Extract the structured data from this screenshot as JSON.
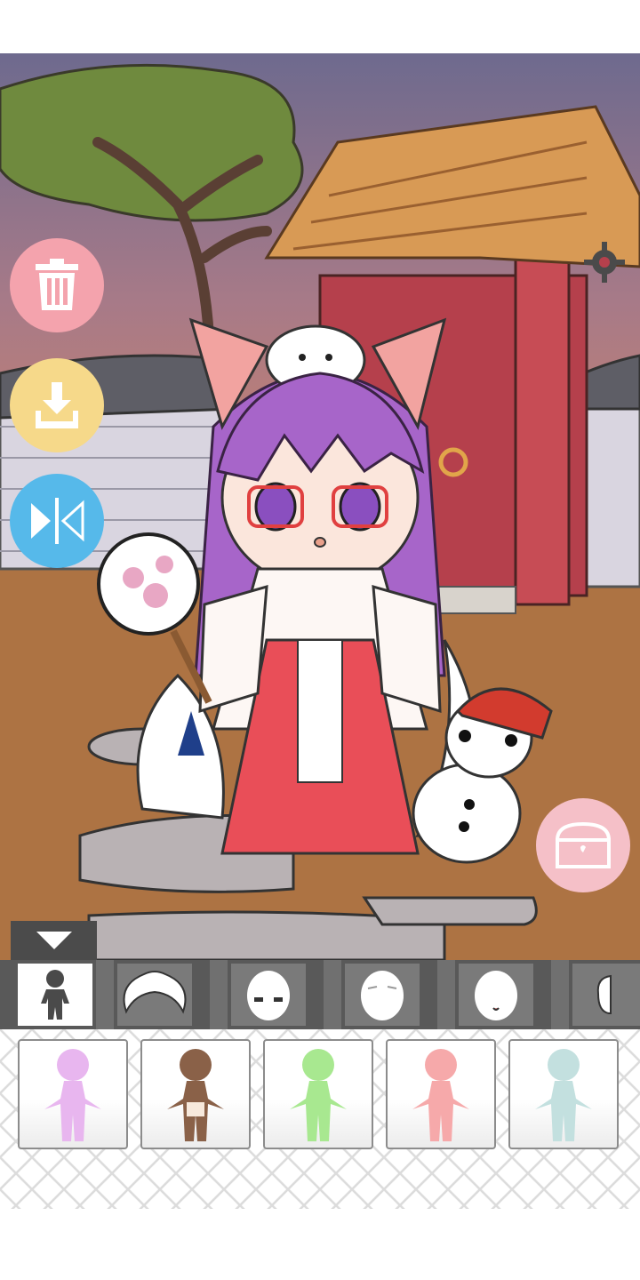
{
  "app": {
    "accent_colors": {
      "delete": "#f4a3ad",
      "download": "#f6d98a",
      "flip": "#56b9ea",
      "chest": "#f5c0c8",
      "toolbar": "#595959"
    }
  },
  "side_buttons": [
    {
      "icon": "trash-icon"
    },
    {
      "icon": "download-icon"
    },
    {
      "icon": "flip-horizontal-icon"
    }
  ],
  "chest_button": {
    "icon": "treasure-chest-icon"
  },
  "settings_button": {
    "icon": "gear-icon"
  },
  "categories": [
    {
      "name": "body",
      "icon": "body-silhouette-icon",
      "selected": true
    },
    {
      "name": "hair",
      "icon": "hair-icon",
      "selected": false
    },
    {
      "name": "eyes",
      "icon": "face-eyes-icon",
      "selected": false
    },
    {
      "name": "eyebrows",
      "icon": "face-brows-icon",
      "selected": false
    },
    {
      "name": "mouth",
      "icon": "face-mouth-icon",
      "selected": false
    },
    {
      "name": "ears",
      "icon": "ear-icon",
      "selected": false
    }
  ],
  "skin_options": [
    {
      "color": "#e8b6ef",
      "shade": "#d9a2e4"
    },
    {
      "color": "#8a6148",
      "shade": "#70503c"
    },
    {
      "color": "#a8e890",
      "shade": "#95d97c"
    },
    {
      "color": "#f6a9aa",
      "shade": "#ea9597"
    },
    {
      "color": "#c3e0df",
      "shade": "#a9cdd0"
    }
  ]
}
